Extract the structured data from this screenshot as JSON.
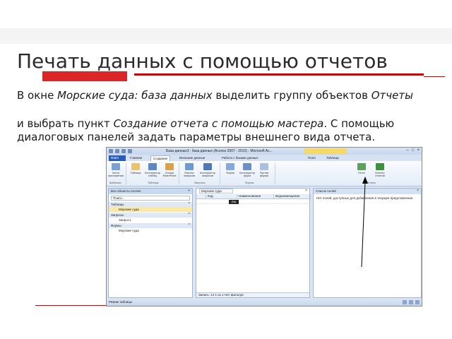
{
  "slide": {
    "title": "Печать данных с помощью отчетов",
    "para1_a": "В окне ",
    "para1_b": "Морские суда: база данных",
    "para1_c": " выделить группу объектов ",
    "para1_d": "Отчеты",
    "para2_a": "и выбрать пункт ",
    "para2_b": "Создание отчета с помощью мастера",
    "para2_c": ". С помощью диалоговых панелей задать параметры внешнего вида отчета."
  },
  "access": {
    "window_title": "База данных3 : база данных (Access 2007 - 2010) - Microsoft Ac...",
    "tabs": [
      "Файл",
      "Главная",
      "Создание",
      "Внешние данные",
      "Работа с базами данных",
      "Поля",
      "Таблица"
    ],
    "ribbon_buttons": [
      "Части приложения",
      "Таблица",
      "Конструктор таблиц",
      "Списки SharePoint",
      "Мастер запросов",
      "Конструктор запросов",
      "Форма",
      "Конструктор форм",
      "Пустая форма",
      "Отчет",
      "Мастер отчетов"
    ],
    "ribbon_groups": [
      "Шаблоны",
      "Таблицы",
      "Запросы",
      "Формы",
      "Отчеты"
    ],
    "nav": {
      "header": "Все объекты Access",
      "search": "Поиск...",
      "groups": [
        {
          "label": "Таблицы",
          "items": [
            "Морские суда"
          ]
        },
        {
          "label": "Запросы",
          "items": [
            "Запрос1"
          ]
        },
        {
          "label": "Формы",
          "items": [
            "Морские суда"
          ]
        }
      ]
    },
    "table": {
      "tab_label": "Морские суда",
      "columns": [
        "Код",
        "Наименование",
        "Водоизмещение"
      ],
      "new_label": "(№)",
      "record_bar": "Запись: 14  1 из 1  Нет фильтра"
    },
    "field_list": {
      "header": "Список полей",
      "text": "Нет полей, доступных для добавления в текущее представление."
    },
    "status_left": "Режим таблицы"
  }
}
